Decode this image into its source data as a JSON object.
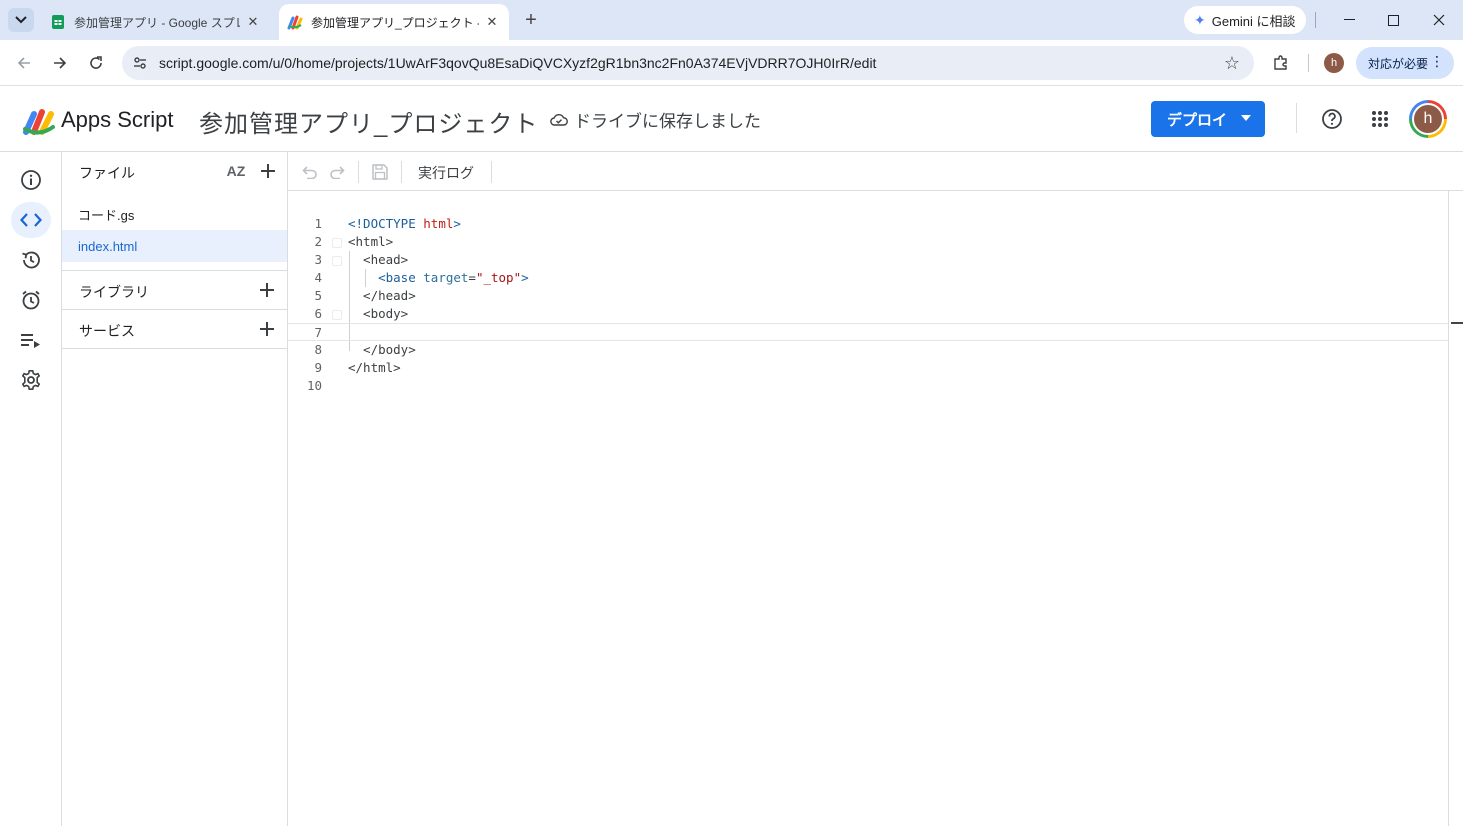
{
  "browser": {
    "tabs": [
      {
        "title": "参加管理アプリ - Google スプレッドシート",
        "active": false
      },
      {
        "title": "参加管理アプリ_プロジェクト - プロジェクト",
        "active": true
      }
    ],
    "gemini_label": "Gemini に相談",
    "url": "script.google.com/u/0/home/projects/1UwArF3qovQu8EsaDiQVCXyzf2gR1bn3nc2Fn0A374EVjVDRR7OJH0IrR/edit",
    "profile_initial": "h",
    "action_label": "対応が必要"
  },
  "header": {
    "app_name": "Apps Script",
    "project_title": "参加管理アプリ_プロジェクト",
    "save_status": "ドライブに保存しました",
    "deploy_label": "デプロイ",
    "avatar_initial": "h"
  },
  "rail": {
    "items": [
      "info-icon",
      "code-icon",
      "history-icon",
      "alarm-icon",
      "executions-icon",
      "settings-icon"
    ],
    "active": "code-icon"
  },
  "files_panel": {
    "files_label": "ファイル",
    "sort_label": "AZ",
    "files": [
      {
        "name": "コード.gs",
        "selected": false
      },
      {
        "name": "index.html",
        "selected": true
      }
    ],
    "libraries_label": "ライブラリ",
    "services_label": "サービス"
  },
  "toolbar": {
    "exec_log_label": "実行ログ"
  },
  "editor": {
    "lines": [
      {
        "n": "1",
        "text": "<!DOCTYPE html>"
      },
      {
        "n": "2",
        "text": "<html>"
      },
      {
        "n": "3",
        "text": "  <head>"
      },
      {
        "n": "4",
        "text": "    <base target=\"_top\">"
      },
      {
        "n": "5",
        "text": "  </head>"
      },
      {
        "n": "6",
        "text": "  <body>"
      },
      {
        "n": "7",
        "text": ""
      },
      {
        "n": "8",
        "text": "  </body>"
      },
      {
        "n": "9",
        "text": "</html>"
      },
      {
        "n": "10",
        "text": ""
      }
    ],
    "current_line": 7
  },
  "colors": {
    "accent": "#1a73e8",
    "selected_bg": "#e8f0fe",
    "selected_text": "#1967d2"
  }
}
